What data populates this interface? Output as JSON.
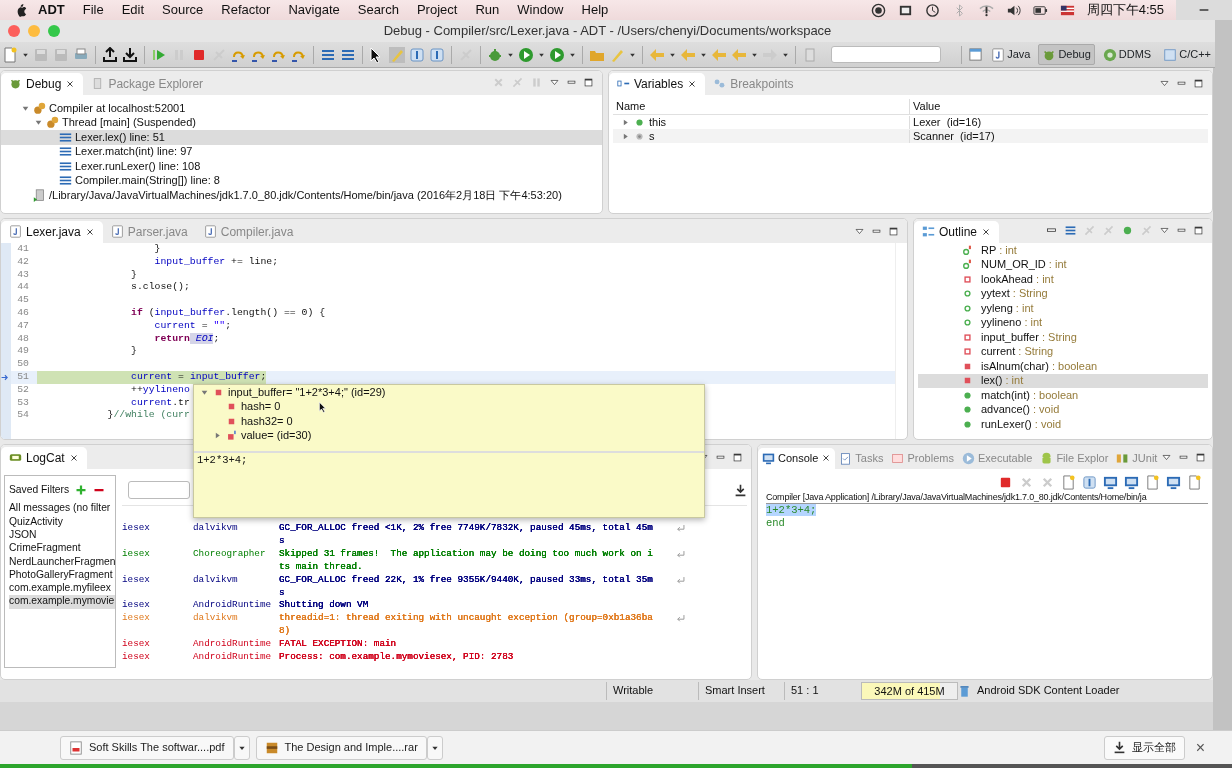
{
  "menubar": {
    "app": "ADT",
    "menus": [
      "File",
      "Edit",
      "Source",
      "Refactor",
      "Navigate",
      "Search",
      "Project",
      "Run",
      "Window",
      "Help"
    ],
    "clock": "周四下午4:55"
  },
  "window": {
    "title": "Debug - Compiler/src/Lexer.java - ADT - /Users/chenyi/Documents/workspace"
  },
  "perspectives": [
    {
      "label": "Java",
      "selected": false
    },
    {
      "label": "Debug",
      "selected": true
    },
    {
      "label": "DDMS",
      "selected": false
    },
    {
      "label": "C/C++",
      "selected": false
    }
  ],
  "debug_view": {
    "tabs": [
      {
        "label": "Debug",
        "selected": true
      },
      {
        "label": "Package Explorer",
        "selected": false
      }
    ],
    "tree": [
      {
        "label": "Compiler at localhost:52001",
        "kind": "target",
        "selected": false,
        "expanded": true,
        "children": [
          {
            "label": "Thread [main] (Suspended)",
            "kind": "thread",
            "selected": false,
            "expanded": true,
            "children": [
              {
                "label": "Lexer.lex() line: 51",
                "kind": "frame",
                "selected": true
              },
              {
                "label": "Lexer.match(int) line: 97",
                "kind": "frame",
                "selected": false
              },
              {
                "label": "Lexer.runLexer() line: 108",
                "kind": "frame",
                "selected": false
              },
              {
                "label": "Compiler.main(String[]) line: 8",
                "kind": "frame",
                "selected": false
              }
            ]
          }
        ]
      },
      {
        "label": "/Library/Java/JavaVirtualMachines/jdk1.7.0_80.jdk/Contents/Home/bin/java (2016年2月18日 下午4:53:20)",
        "kind": "process",
        "selected": false
      }
    ]
  },
  "variables_view": {
    "tabs": [
      {
        "label": "Variables",
        "selected": true
      },
      {
        "label": "Breakpoints",
        "selected": false
      }
    ],
    "columns": [
      "Name",
      "Value"
    ],
    "rows": [
      {
        "name": "this",
        "value": "Lexer  (id=16)",
        "kind": "object",
        "expanded": false
      },
      {
        "name": "s",
        "value": "Scanner  (id=17)",
        "kind": "local",
        "expanded": false
      }
    ]
  },
  "editor": {
    "tabs": [
      {
        "label": "Lexer.java",
        "selected": true
      },
      {
        "label": "Parser.java",
        "selected": false
      },
      {
        "label": "Compiler.java",
        "selected": false
      }
    ],
    "lines": [
      {
        "number": "41",
        "current": false,
        "tokens": [
          {
            "text": "                    }",
            "kind": "plain"
          }
        ]
      },
      {
        "number": "42",
        "current": false,
        "tokens": [
          {
            "text": "                    input_buffer",
            "kind": "field"
          },
          {
            "text": " += line;",
            "kind": "plain"
          }
        ]
      },
      {
        "number": "43",
        "current": false,
        "tokens": [
          {
            "text": "                }",
            "kind": "plain"
          }
        ]
      },
      {
        "number": "44",
        "current": false,
        "tokens": [
          {
            "text": "                s.close();",
            "kind": "plain"
          }
        ]
      },
      {
        "number": "45",
        "current": false
      },
      {
        "number": "46",
        "current": false,
        "tokens": [
          {
            "text": "                if",
            "kind": "keyword"
          },
          {
            "text": " (",
            "kind": "plain"
          },
          {
            "text": "input_buffer",
            "kind": "field"
          },
          {
            "text": ".length() == 0) {",
            "kind": "plain"
          }
        ]
      },
      {
        "number": "47",
        "current": false,
        "tokens": [
          {
            "text": "                    current",
            "kind": "field"
          },
          {
            "text": " = ",
            "kind": "plain"
          },
          {
            "text": "\"\"",
            "kind": "string"
          },
          {
            "text": ";",
            "kind": "plain"
          }
        ]
      },
      {
        "number": "48",
        "current": false,
        "tokens": [
          {
            "text": "                    return",
            "kind": "keyword"
          },
          {
            "text": " EOI",
            "kind": "static"
          },
          {
            "text": ";",
            "kind": "plain"
          }
        ]
      },
      {
        "number": "49",
        "current": false,
        "tokens": [
          {
            "text": "                }",
            "kind": "plain"
          }
        ]
      },
      {
        "number": "50",
        "current": false
      },
      {
        "number": "51",
        "current": true,
        "tokens": [
          {
            "text": "                current",
            "kind": "field"
          },
          {
            "text": " = ",
            "kind": "plain"
          },
          {
            "text": "input_buffer",
            "kind": "field"
          },
          {
            "text": ";",
            "kind": "plain"
          }
        ]
      },
      {
        "number": "52",
        "current": false,
        "tokens": [
          {
            "text": "                ++",
            "kind": "plain"
          },
          {
            "text": "yylineno",
            "kind": "field"
          }
        ]
      },
      {
        "number": "53",
        "current": false,
        "tokens": [
          {
            "text": "                current",
            "kind": "field"
          },
          {
            "text": ".tr",
            "kind": "plain"
          }
        ]
      },
      {
        "number": "54",
        "current": false,
        "tokens": [
          {
            "text": "            }",
            "kind": "plain"
          },
          {
            "text": "//while (curr",
            "kind": "comment"
          }
        ]
      }
    ]
  },
  "hover_popup": {
    "rows": [
      {
        "label": "input_buffer= \"1+2*3+4;\" (id=29)",
        "kind": "private",
        "expanded": true,
        "children": [
          {
            "label": "hash= 0",
            "kind": "private"
          },
          {
            "label": "hash32= 0",
            "kind": "private"
          },
          {
            "label": "value= (id=30)",
            "kind": "final",
            "expanded": false
          }
        ]
      }
    ],
    "detail": "1+2*3+4;"
  },
  "outline": {
    "title": "Outline",
    "items": [
      {
        "name": "RP",
        "type": ": int",
        "kind": "constant",
        "selected": false
      },
      {
        "name": "NUM_OR_ID",
        "type": ": int",
        "kind": "constant",
        "selected": false
      },
      {
        "name": "lookAhead",
        "type": ": int",
        "kind": "private-field",
        "selected": false
      },
      {
        "name": "yytext",
        "type": ": String",
        "kind": "public-field",
        "selected": false
      },
      {
        "name": "yyleng",
        "type": ": int",
        "kind": "public-field",
        "selected": false
      },
      {
        "name": "yylineno",
        "type": ": int",
        "kind": "public-field",
        "selected": false
      },
      {
        "name": "input_buffer",
        "type": ": String",
        "kind": "private-field",
        "selected": false
      },
      {
        "name": "current",
        "type": ": String",
        "kind": "private-field",
        "selected": false
      },
      {
        "name": "isAlnum(char)",
        "type": ": boolean",
        "kind": "private-method",
        "selected": false
      },
      {
        "name": "lex()",
        "type": ": int",
        "kind": "private-method",
        "selected": true
      },
      {
        "name": "match(int)",
        "type": ": boolean",
        "kind": "public-method",
        "selected": false
      },
      {
        "name": "advance()",
        "type": ": void",
        "kind": "public-method",
        "selected": false
      },
      {
        "name": "runLexer()",
        "type": ": void",
        "kind": "public-method",
        "selected": false
      }
    ]
  },
  "logcat": {
    "title": "LogCat",
    "filters_title": "Saved Filters",
    "filters": [
      {
        "label": "All messages (no filter",
        "selected": false
      },
      {
        "label": "QuizActivity",
        "selected": false
      },
      {
        "label": "JSON",
        "selected": false
      },
      {
        "label": "CrimeFragment",
        "selected": false
      },
      {
        "label": "NerdLauncherFragmen",
        "selected": false
      },
      {
        "label": "PhotoGalleryFragment",
        "selected": false
      },
      {
        "label": "com.example.myfileex",
        "selected": false
      },
      {
        "label": "com.example.mymovie",
        "selected": true
      }
    ],
    "rows": [
      {
        "application": "iesex",
        "tag": "dalvikvm",
        "message": [
          "GC_FOR_ALLOC freed <1K, 2% free 7749K/7832K, paused 45ms, total 45m",
          "s"
        ],
        "color": "#00007f"
      },
      {
        "application": "iesex",
        "tag": "Choreographer",
        "message": [
          "Skipped 31 frames!  The application may be doing too much work on i",
          "ts main thread."
        ],
        "color": "#007f00"
      },
      {
        "application": "iesex",
        "tag": "dalvikvm",
        "message": [
          "GC_FOR_ALLOC freed 22K, 1% free 9355K/9440K, paused 33ms, total 35m",
          "s"
        ],
        "color": "#00007f"
      },
      {
        "application": "iesex",
        "tag": "AndroidRuntime",
        "message": [
          "Shutting down VM"
        ],
        "color": "#00007f"
      },
      {
        "application": "iesex",
        "tag": "dalvikvm",
        "message": [
          "threadid=1: thread exiting with uncaught exception (group=0xb1a36ba",
          "8)"
        ],
        "color": "#e07a1e"
      },
      {
        "application": "iesex",
        "tag": "AndroidRuntime",
        "message": [
          "FATAL EXCEPTION: main"
        ],
        "color": "#d0021b"
      },
      {
        "application": "iesex",
        "tag": "AndroidRuntime",
        "message": [
          "Process: com.example.mymoviesex, PID: 2783"
        ],
        "color": "#d0021b"
      }
    ]
  },
  "console": {
    "tabs": [
      {
        "label": "Console",
        "selected": true
      },
      {
        "label": "Tasks",
        "selected": false
      },
      {
        "label": "Problems",
        "selected": false
      },
      {
        "label": "Executable",
        "selected": false
      },
      {
        "label": "File Explor",
        "selected": false
      },
      {
        "label": "JUnit",
        "selected": false
      }
    ],
    "header": "Compiler [Java Application] /Library/Java/JavaVirtualMachines/jdk1.7.0_80.jdk/Contents/Home/bin/ja",
    "output": [
      {
        "text": "1+2*3+4;",
        "highlighted": true
      },
      {
        "text": "end",
        "highlighted": false
      }
    ]
  },
  "status_bar": {
    "mode": "Writable",
    "insert": "Smart Insert",
    "position": "51 : 1",
    "heap": {
      "text": "342M of 415M",
      "level": 0.82
    },
    "job": "Android SDK Content Loader"
  },
  "downloads": {
    "items": [
      {
        "name": "Soft Skills The softwar....pdf",
        "kind": "pdf"
      },
      {
        "name": "The Design and Imple....rar",
        "kind": "archive"
      }
    ],
    "show_all": "显示全部",
    "close": "×"
  },
  "video_progress": {
    "level": 0.74
  }
}
